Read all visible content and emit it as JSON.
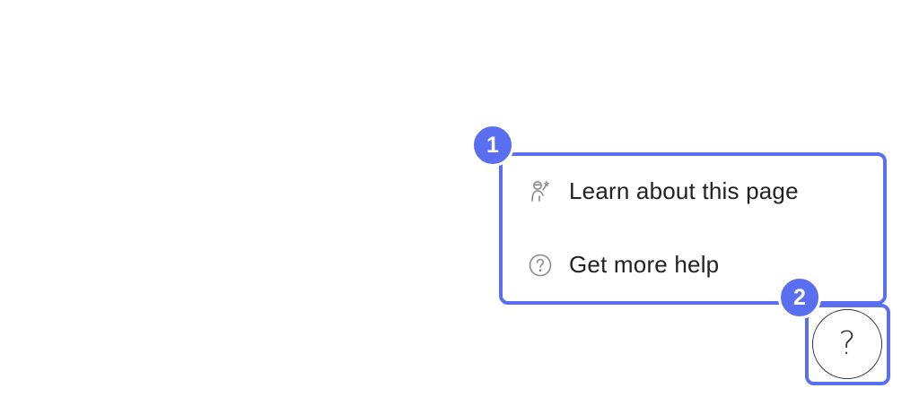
{
  "help_menu": {
    "items": [
      {
        "label": "Learn about this page",
        "icon": "guide-person-icon"
      },
      {
        "label": "Get more help",
        "icon": "question-circle-icon"
      }
    ]
  },
  "help_button": {
    "glyph": "?",
    "icon": "question-mark-icon"
  },
  "annotations": {
    "badge_1": "1",
    "badge_2": "2",
    "highlight_color": "#5a6ff0"
  }
}
